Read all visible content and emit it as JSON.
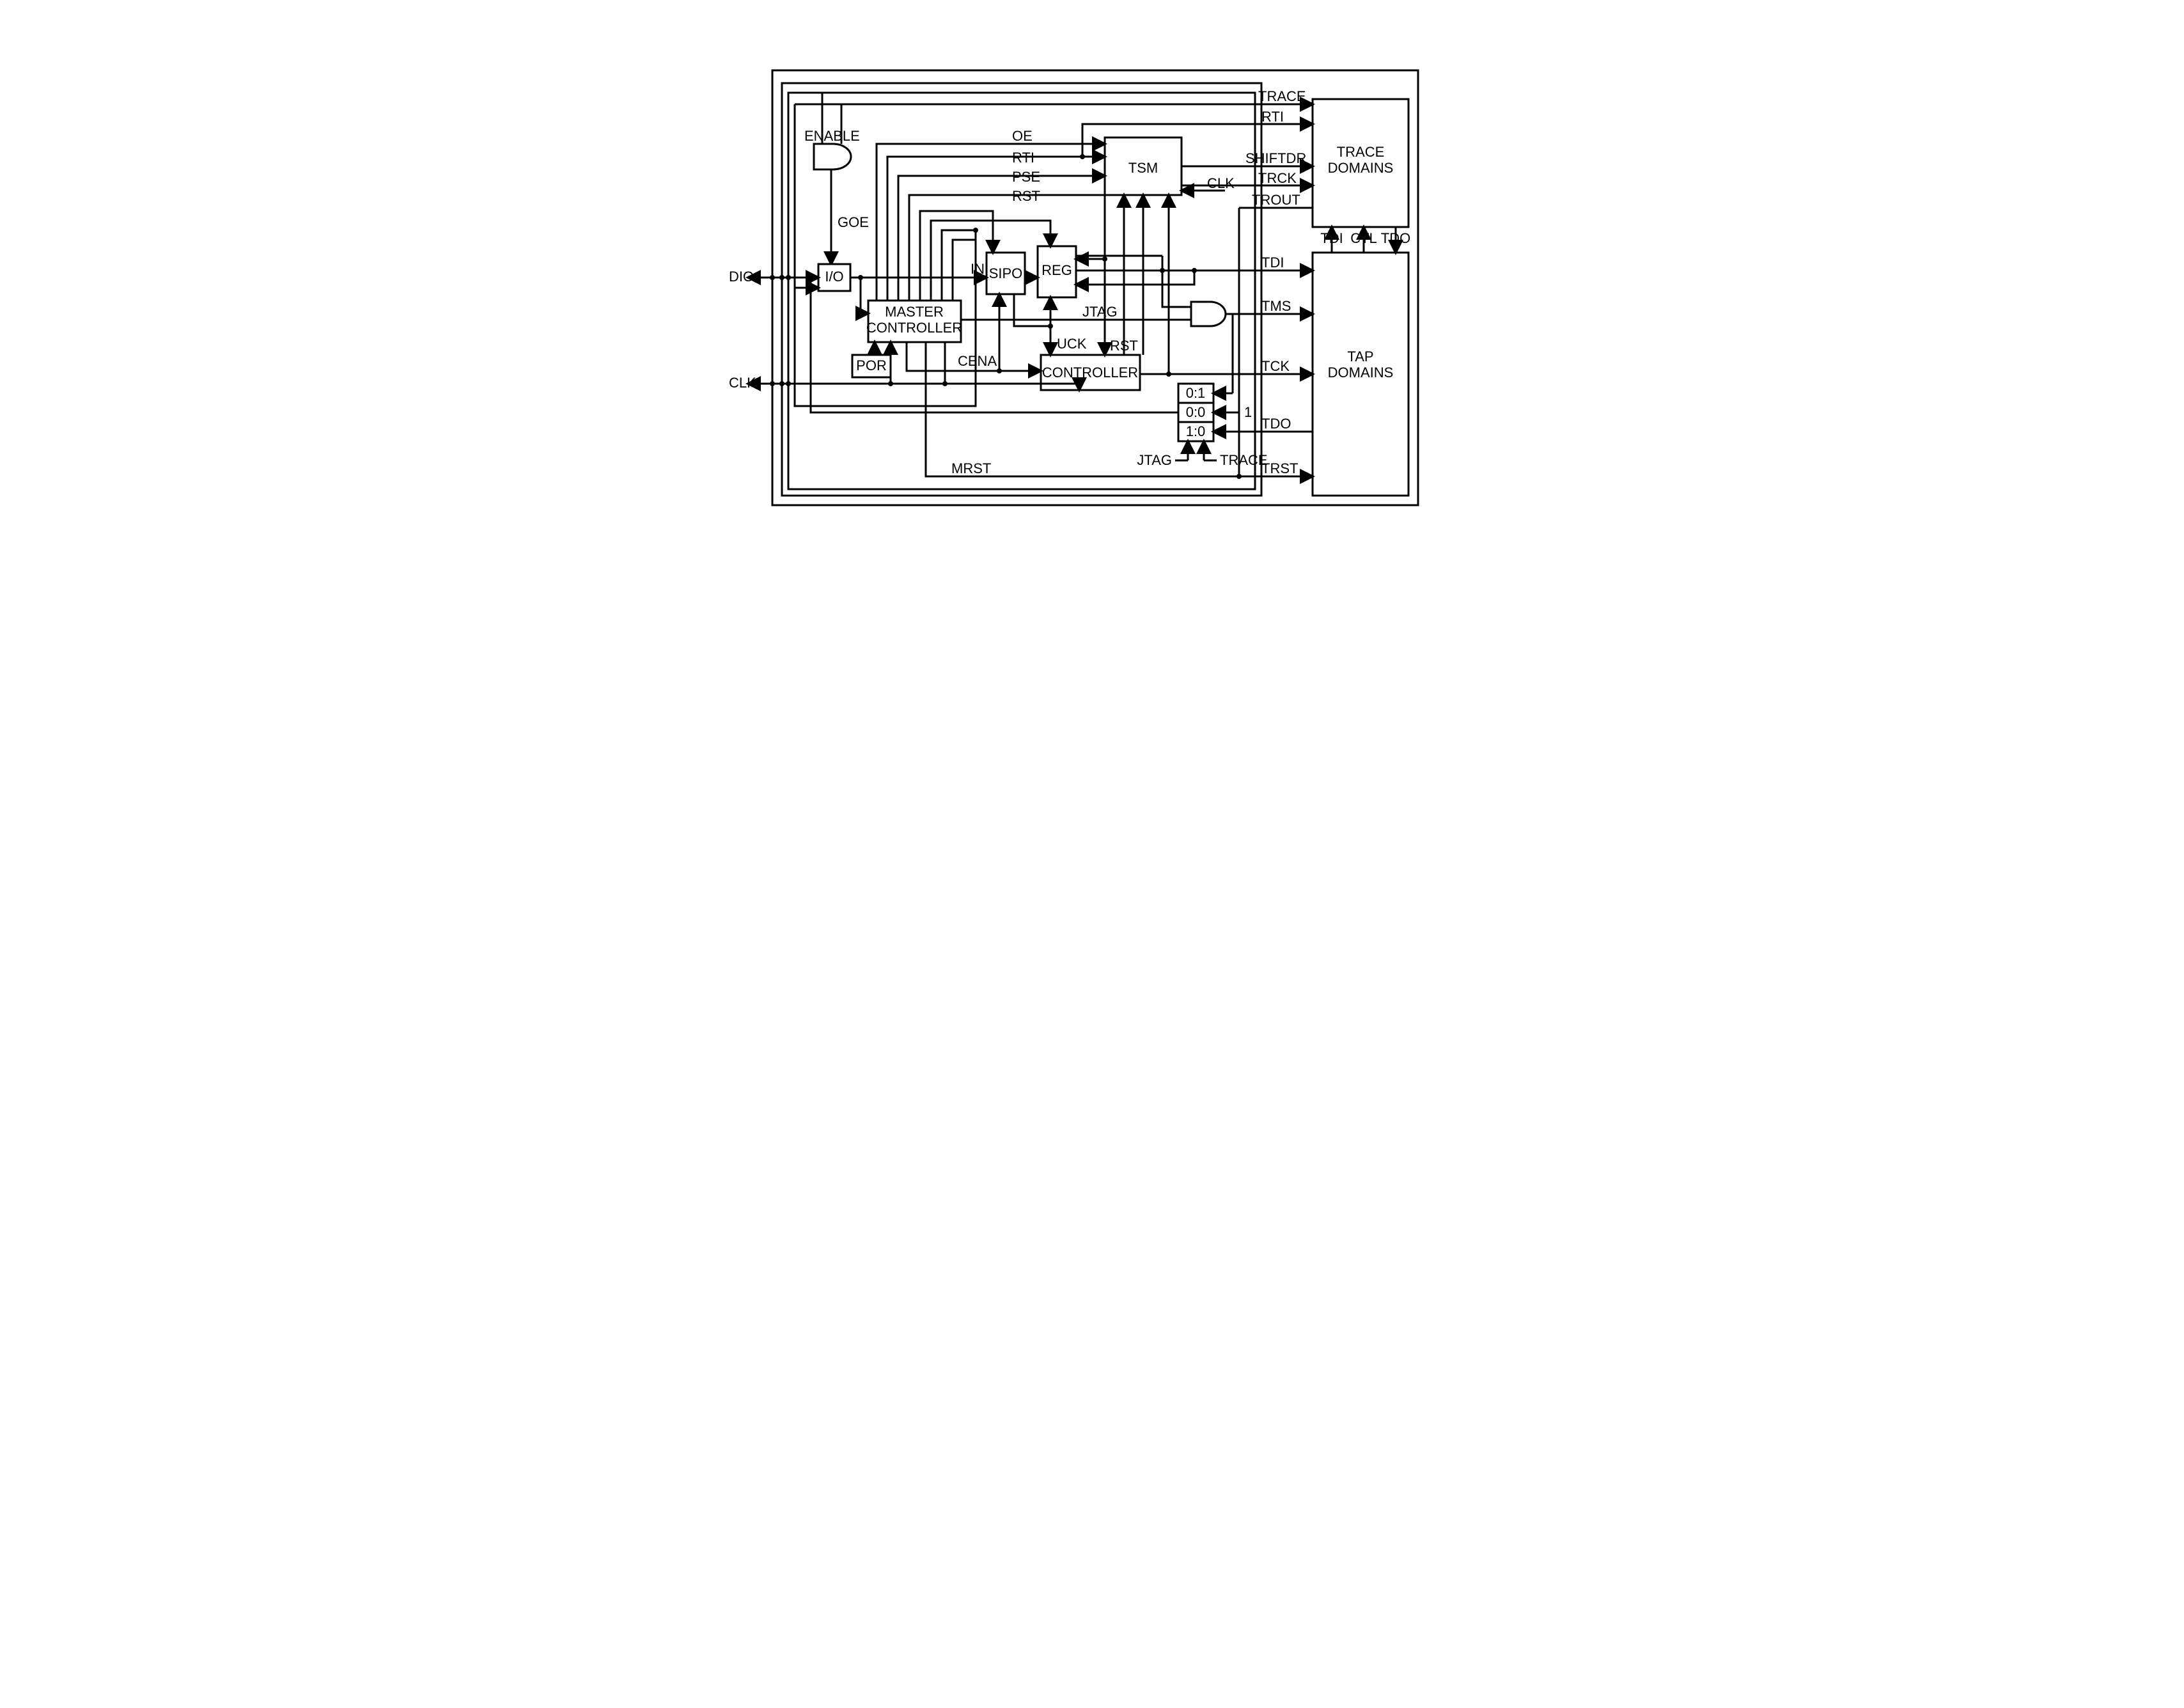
{
  "blocks": {
    "io": "I/O",
    "master_controller_l1": "MASTER",
    "master_controller_l2": "CONTROLLER",
    "por": "POR",
    "sipo": "SIPO",
    "reg": "REG",
    "tsm": "TSM",
    "controller": "CONTROLLER",
    "mux_0": "0:1",
    "mux_1": "0:0",
    "mux_2": "1:0",
    "trace_domains_l1": "TRACE",
    "trace_domains_l2": "DOMAINS",
    "tap_domains_l1": "TAP",
    "tap_domains_l2": "DOMAINS"
  },
  "signals": {
    "enable": "ENABLE",
    "goe": "GOE",
    "dio": "DIO",
    "clk_left": "CLK",
    "oe": "OE",
    "rti_top": "RTI",
    "pse": "PSE",
    "rst_top": "RST",
    "in": "IN",
    "jtag": "JTAG",
    "uck": "UCK",
    "rst_mid": "RST",
    "cena": "CENA",
    "mrst": "MRST",
    "clk_tsm": "CLK",
    "trace": "TRACE",
    "rti_out": "RTI",
    "shiftdr": "SHIFTDR",
    "trck": "TRCK",
    "trout": "TROUT",
    "tdi_label": "TDI",
    "ctl_label": "CTL",
    "tdo_label": "TDO",
    "tdi": "TDI",
    "tms": "TMS",
    "tck": "TCK",
    "tdo": "TDO",
    "trst": "TRST",
    "one": "1",
    "jtag_sel": "JTAG",
    "trace_sel": "TRACE"
  }
}
